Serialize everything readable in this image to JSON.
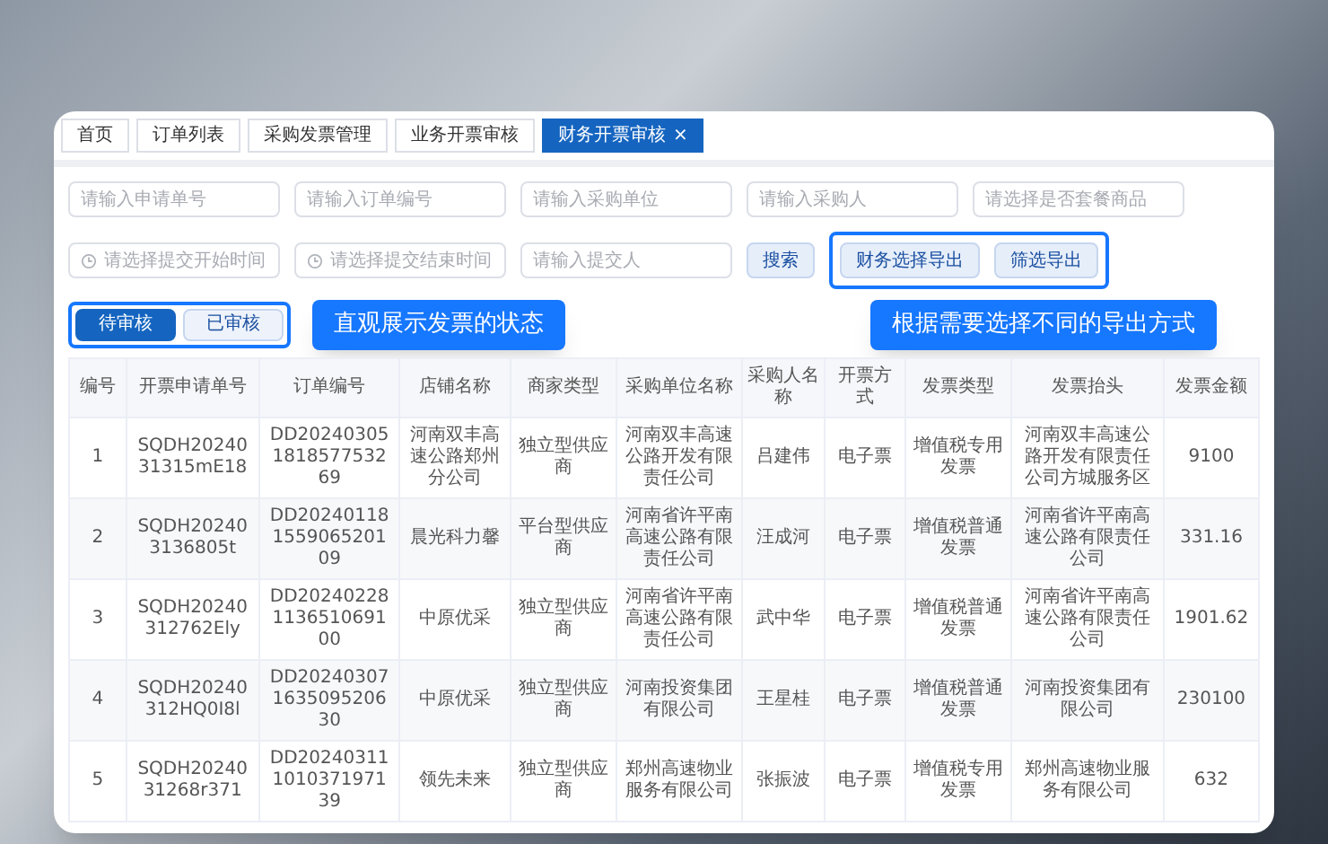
{
  "tabs": [
    {
      "label": "首页",
      "selected": false
    },
    {
      "label": "订单列表",
      "selected": false
    },
    {
      "label": "采购发票管理",
      "selected": false
    },
    {
      "label": "业务开票审核",
      "selected": false
    },
    {
      "label": "财务开票审核",
      "selected": true,
      "close": "×"
    }
  ],
  "filters": [
    {
      "kind": "text",
      "placeholder": "请输入申请单号"
    },
    {
      "kind": "text",
      "placeholder": "请输入订单编号"
    },
    {
      "kind": "text",
      "placeholder": "请输入采购单位"
    },
    {
      "kind": "text",
      "placeholder": "请输入采购人"
    },
    {
      "kind": "text",
      "placeholder": "请选择是否套餐商品"
    }
  ],
  "filters_2": [
    {
      "kind": "date",
      "placeholder": "请选择提交开始时间"
    },
    {
      "kind": "date",
      "placeholder": "请选择提交结束时间"
    },
    {
      "kind": "text",
      "placeholder": "请输入提交人"
    }
  ],
  "search_button": "搜索",
  "export_buttons": [
    "财务选择导出",
    "筛选导出"
  ],
  "status_tabs": [
    {
      "label": "待审核",
      "selected": true
    },
    {
      "label": "已审核",
      "selected": false
    }
  ],
  "callouts": [
    "直观展示发票的状态",
    "根据需要选择不同的导出方式"
  ],
  "table": {
    "columns": [
      "编号",
      "开票申请单号",
      "订单编号",
      "店铺名称",
      "商家类型",
      "采购单位名称",
      "采购人名称",
      "开票方式",
      "发票类型",
      "发票抬头",
      "发票金额"
    ],
    "rows": [
      [
        "1",
        "SQDH2024031315mE18",
        "DD20240305181857753269",
        "河南双丰高速公路郑州分公司",
        "独立型供应商",
        "河南双丰高速公路开发有限责任公司",
        "吕建伟",
        "电子票",
        "增值税专用发票",
        "河南双丰高速公路开发有限责任公司方城服务区",
        "9100"
      ],
      [
        "2",
        "SQDH202403136805t",
        "DD20240118155906520109",
        "晨光科力馨",
        "平台型供应商",
        "河南省许平南高速公路有限责任公司",
        "汪成河",
        "电子票",
        "增值税普通发票",
        "河南省许平南高速公路有限责任公司",
        "331.16"
      ],
      [
        "3",
        "SQDH20240312762Ely",
        "DD20240228113651069100",
        "中原优采",
        "独立型供应商",
        "河南省许平南高速公路有限责任公司",
        "武中华",
        "电子票",
        "增值税普通发票",
        "河南省许平南高速公路有限责任公司",
        "1901.62"
      ],
      [
        "4",
        "SQDH20240312HQ0I8l",
        "DD20240307163509520630",
        "中原优采",
        "独立型供应商",
        "河南投资集团有限公司",
        "王星桂",
        "电子票",
        "增值税普通发票",
        "河南投资集团有限公司",
        "230100"
      ],
      [
        "5",
        "SQDH2024031268r371",
        "DD20240311101037197139",
        "领先未来",
        "独立型供应商",
        "郑州高速物业服务有限公司",
        "张振波",
        "电子票",
        "增值税专用发票",
        "郑州高速物业服务有限公司",
        "632"
      ]
    ]
  }
}
